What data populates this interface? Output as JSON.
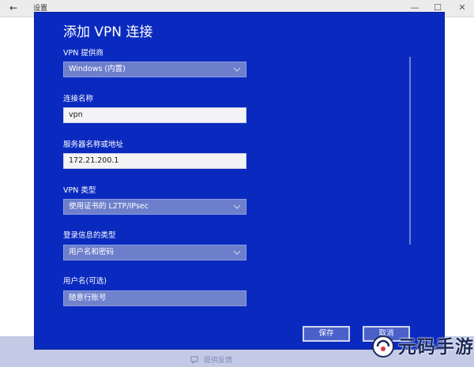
{
  "titlebar": {
    "title": "设置",
    "back_glyph": "←",
    "minimize_glyph": "—",
    "maximize_glyph": "☐",
    "close_glyph": "✕"
  },
  "dialog": {
    "title": "添加 VPN 连接",
    "fields": {
      "provider": {
        "label": "VPN 提供商",
        "value": "Windows (内置)"
      },
      "connection_name": {
        "label": "连接名称",
        "value": "vpn"
      },
      "server": {
        "label": "服务器名称或地址",
        "value": "172.21.200.1"
      },
      "vpn_type": {
        "label": "VPN 类型",
        "value": "使用证书的 L2TP/IPsec"
      },
      "signin_type": {
        "label": "登录信息的类型",
        "value": "用户名和密码"
      },
      "username": {
        "label": "用户名(可选)",
        "value": "随意行账号"
      }
    },
    "buttons": {
      "save": "保存",
      "cancel": "取消"
    }
  },
  "footer": {
    "feedback": "提供反馈"
  },
  "watermark": {
    "text": "元码手游网"
  },
  "colors": {
    "dialog_bg": "#0a2abf",
    "accent": "#4b60c8"
  }
}
